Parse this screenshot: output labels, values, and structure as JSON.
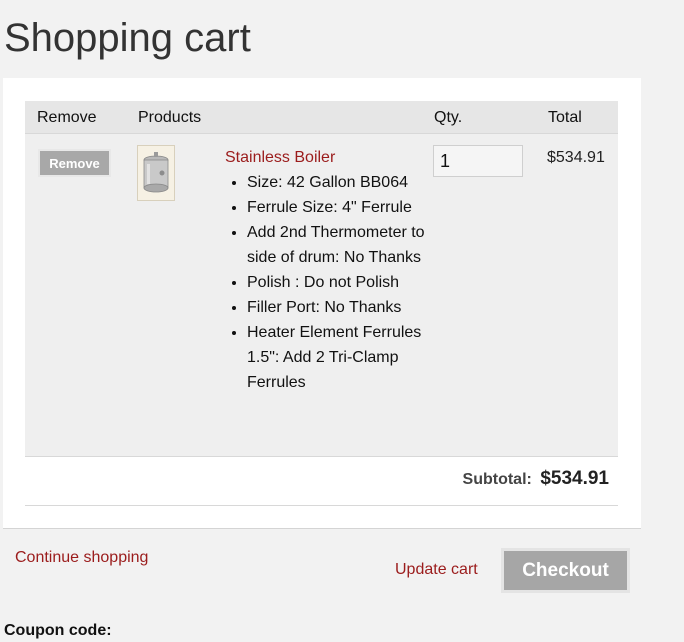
{
  "page": {
    "title": "Shopping cart"
  },
  "table": {
    "headers": {
      "remove": "Remove",
      "products": "Products",
      "qty": "Qty.",
      "total": "Total"
    }
  },
  "items": [
    {
      "remove_label": "Remove",
      "name": "Stainless Boiler",
      "options": [
        "Size: 42 Gallon BB064",
        "Ferrule Size: 4\" Ferrule",
        "Add 2nd Thermometer to side of drum: No Thanks",
        "Polish : Do not Polish",
        "Filler Port: No Thanks",
        "Heater Element Ferrules 1.5\": Add 2 Tri-Clamp Ferrules"
      ],
      "qty": "1",
      "total": "$534.91"
    }
  ],
  "summary": {
    "subtotal_label": "Subtotal:",
    "subtotal_value": "$534.91"
  },
  "actions": {
    "continue_label": "Continue shopping",
    "update_label": "Update cart",
    "checkout_label": "Checkout"
  },
  "coupon": {
    "label": "Coupon code:"
  },
  "colors": {
    "link": "#9b1c1c",
    "button": "#a6a6a6",
    "background": "#f2f2f2"
  }
}
